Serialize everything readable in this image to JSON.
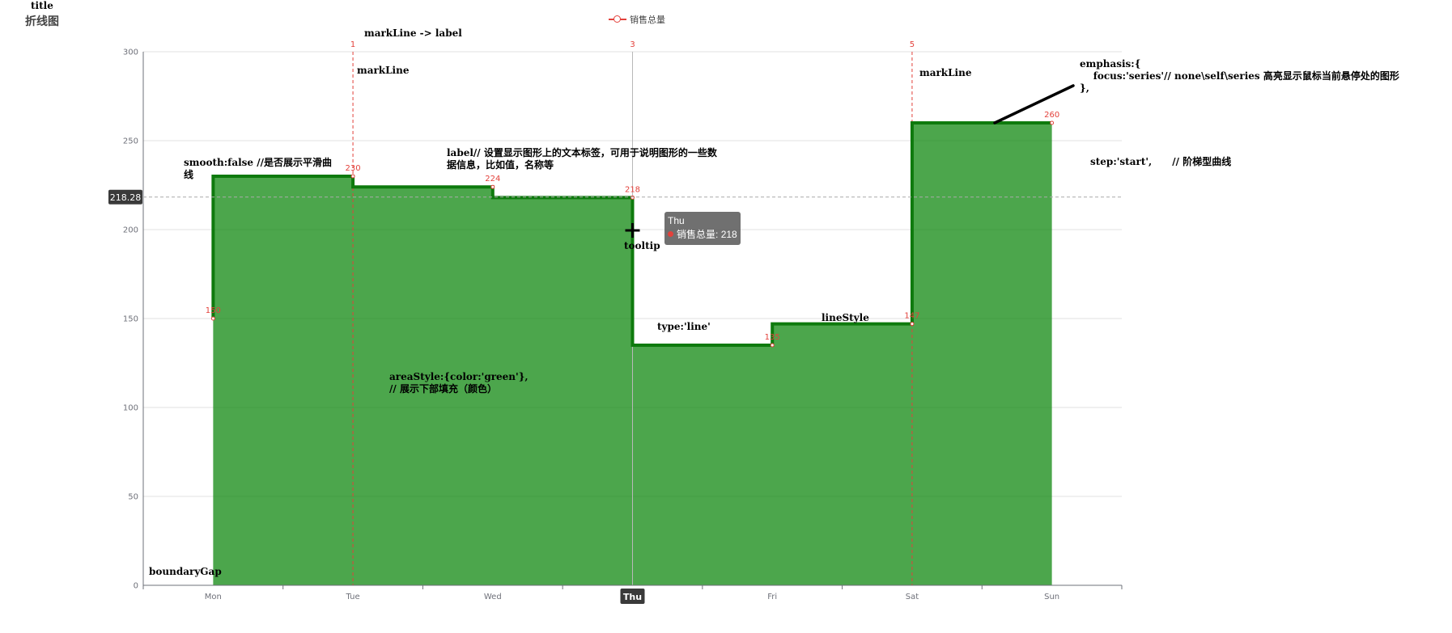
{
  "title": "title",
  "subtitle": "折线图",
  "legend": {
    "label": "销售总量"
  },
  "chart_data": {
    "type": "line",
    "step": "start",
    "categories": [
      "Mon",
      "Tue",
      "Wed",
      "Thu",
      "Fri",
      "Sat",
      "Sun"
    ],
    "series": [
      {
        "name": "销售总量",
        "values": [
          150,
          230,
          224,
          218,
          135,
          147,
          260
        ],
        "color": "#e3413b",
        "line_color": "#0e7a0d",
        "area_color": "green"
      }
    ],
    "ylim": [
      0,
      300
    ],
    "yticks": [
      0,
      50,
      100,
      150,
      200,
      250,
      300
    ],
    "xlabel": "",
    "ylabel": "",
    "grid": true,
    "legend_position": "top-center",
    "highlighted_category": "Thu",
    "pointer_value": "218.28",
    "mark_lines": [
      {
        "label": "1",
        "x_index": 1
      },
      {
        "label": "3",
        "x_index": 3
      },
      {
        "label": "5",
        "x_index": 5
      }
    ],
    "data_labels": [
      "150",
      "230",
      "224",
      "218",
      "135",
      "147",
      "260"
    ]
  },
  "tooltip": {
    "title": "Thu",
    "series_name": "销售总量",
    "value": "218"
  },
  "annotations": {
    "markline_label": "markLine -> label",
    "markline_1": "markLine",
    "markline_2": "markLine",
    "emphasis": "emphasis:{\n    focus:'series'// none\\self\\series 高亮显示鼠标当前悬停处的图形\n},",
    "smooth": "smooth:false //是否展示平滑曲\n线",
    "label": "label// 设置显示图形上的文本标签，可用于说明图形的一些数\n据信息，比如值，名称等",
    "step": "step:'start',      // 阶梯型曲线",
    "tooltip": "tooltip",
    "type": "type:'line'",
    "line_style": "lineStyle",
    "area_style": "areaStyle:{color:'green'},\n// 展示下部填充（颜色）",
    "boundary_gap": "boundaryGap"
  }
}
